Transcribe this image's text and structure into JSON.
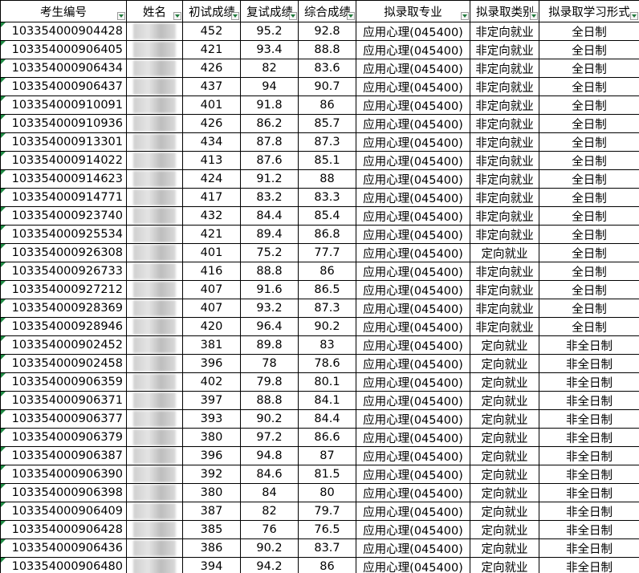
{
  "headers": [
    "考生编号",
    "姓名",
    "初试成绩",
    "复试成绩",
    "综合成绩",
    "拟录取专业",
    "拟录取类别",
    "拟录取学习形式"
  ],
  "rows": [
    [
      "103354000904428",
      "",
      "452",
      "95.2",
      "92.8",
      "应用心理(045400)",
      "非定向就业",
      "全日制"
    ],
    [
      "103354000906405",
      "",
      "421",
      "93.4",
      "88.8",
      "应用心理(045400)",
      "非定向就业",
      "全日制"
    ],
    [
      "103354000906434",
      "",
      "426",
      "82",
      "83.6",
      "应用心理(045400)",
      "非定向就业",
      "全日制"
    ],
    [
      "103354000906437",
      "",
      "437",
      "94",
      "90.7",
      "应用心理(045400)",
      "非定向就业",
      "全日制"
    ],
    [
      "103354000910091",
      "",
      "401",
      "91.8",
      "86",
      "应用心理(045400)",
      "非定向就业",
      "全日制"
    ],
    [
      "103354000910936",
      "",
      "426",
      "86.2",
      "85.7",
      "应用心理(045400)",
      "非定向就业",
      "全日制"
    ],
    [
      "103354000913301",
      "",
      "434",
      "87.8",
      "87.3",
      "应用心理(045400)",
      "非定向就业",
      "全日制"
    ],
    [
      "103354000914022",
      "",
      "413",
      "87.6",
      "85.1",
      "应用心理(045400)",
      "非定向就业",
      "全日制"
    ],
    [
      "103354000914623",
      "",
      "424",
      "91.2",
      "88",
      "应用心理(045400)",
      "非定向就业",
      "全日制"
    ],
    [
      "103354000914771",
      "",
      "417",
      "83.2",
      "83.3",
      "应用心理(045400)",
      "非定向就业",
      "全日制"
    ],
    [
      "103354000923740",
      "",
      "432",
      "84.4",
      "85.4",
      "应用心理(045400)",
      "非定向就业",
      "全日制"
    ],
    [
      "103354000925534",
      "",
      "421",
      "89.4",
      "86.8",
      "应用心理(045400)",
      "非定向就业",
      "全日制"
    ],
    [
      "103354000926308",
      "",
      "401",
      "75.2",
      "77.7",
      "应用心理(045400)",
      "定向就业",
      "全日制"
    ],
    [
      "103354000926733",
      "",
      "416",
      "88.8",
      "86",
      "应用心理(045400)",
      "非定向就业",
      "全日制"
    ],
    [
      "103354000927212",
      "",
      "407",
      "91.6",
      "86.5",
      "应用心理(045400)",
      "非定向就业",
      "全日制"
    ],
    [
      "103354000928369",
      "",
      "407",
      "93.2",
      "87.3",
      "应用心理(045400)",
      "非定向就业",
      "全日制"
    ],
    [
      "103354000928946",
      "",
      "420",
      "96.4",
      "90.2",
      "应用心理(045400)",
      "非定向就业",
      "全日制"
    ],
    [
      "103354000902452",
      "",
      "381",
      "89.8",
      "83",
      "应用心理(045400)",
      "定向就业",
      "非全日制"
    ],
    [
      "103354000902458",
      "",
      "396",
      "78",
      "78.6",
      "应用心理(045400)",
      "定向就业",
      "非全日制"
    ],
    [
      "103354000906359",
      "",
      "402",
      "79.8",
      "80.1",
      "应用心理(045400)",
      "定向就业",
      "非全日制"
    ],
    [
      "103354000906371",
      "",
      "397",
      "88.8",
      "84.1",
      "应用心理(045400)",
      "定向就业",
      "非全日制"
    ],
    [
      "103354000906377",
      "",
      "393",
      "90.2",
      "84.4",
      "应用心理(045400)",
      "定向就业",
      "非全日制"
    ],
    [
      "103354000906379",
      "",
      "380",
      "97.2",
      "86.6",
      "应用心理(045400)",
      "定向就业",
      "非全日制"
    ],
    [
      "103354000906387",
      "",
      "396",
      "94.8",
      "87",
      "应用心理(045400)",
      "定向就业",
      "非全日制"
    ],
    [
      "103354000906390",
      "",
      "392",
      "84.6",
      "81.5",
      "应用心理(045400)",
      "定向就业",
      "非全日制"
    ],
    [
      "103354000906398",
      "",
      "380",
      "84",
      "80",
      "应用心理(045400)",
      "定向就业",
      "非全日制"
    ],
    [
      "103354000906409",
      "",
      "387",
      "82",
      "79.7",
      "应用心理(045400)",
      "定向就业",
      "非全日制"
    ],
    [
      "103354000906428",
      "",
      "385",
      "76",
      "76.5",
      "应用心理(045400)",
      "定向就业",
      "非全日制"
    ],
    [
      "103354000906436",
      "",
      "386",
      "90.2",
      "83.7",
      "应用心理(045400)",
      "定向就业",
      "非全日制"
    ],
    [
      "103354000906480",
      "",
      "394",
      "94.2",
      "86",
      "应用心理(045400)",
      "定向就业",
      "非全日制"
    ]
  ],
  "colors": {
    "border": "#000000",
    "cell_marker": "#1e8a43",
    "filter_arrow": "#1f7a3a"
  },
  "icons": {
    "filter": "filter-dropdown-icon"
  }
}
